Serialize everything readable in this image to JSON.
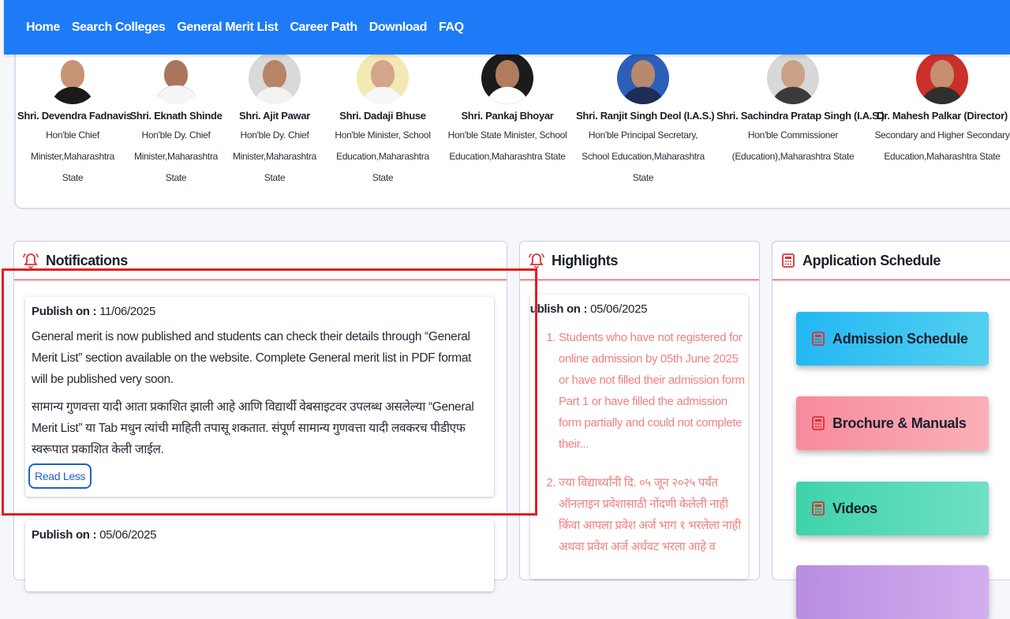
{
  "nav": {
    "items": [
      "Home",
      "Search Colleges",
      "General Merit List",
      "Career Path",
      "Download",
      "FAQ"
    ]
  },
  "dignitaries": [
    {
      "name": "Shri. Devendra Fadnavis",
      "role": [
        "Hon'ble Chief",
        "Minister,Maharashtra",
        "State"
      ],
      "accent": "#ffffff"
    },
    {
      "name": "Shri. Eknath Shinde",
      "role": [
        "Hon'ble Dy. Chief",
        "Minister,Maharashtra",
        "State"
      ],
      "accent": "#ffffff"
    },
    {
      "name": "Shri. Ajit Pawar",
      "role": [
        "Hon'ble Dy. Chief",
        "Minister,Maharashtra",
        "State"
      ],
      "accent": "#d9d9d9"
    },
    {
      "name": "Shri. Dadaji Bhuse",
      "role": [
        "Hon'ble Minister, School",
        "Education,Maharashtra",
        "State"
      ],
      "accent": "#f3e9b4"
    },
    {
      "name": "Shri. Pankaj Bhoyar",
      "role": [
        "Hon'ble State Minister, School",
        "Education,Maharashtra State"
      ],
      "accent": "#1b1b1b"
    },
    {
      "name": "Shri. Ranjit Singh Deol (I.A.S.)",
      "role": [
        "Hon'ble Principal Secretary,",
        "School Education,Maharashtra",
        "State"
      ],
      "accent": "#2c5fb8"
    },
    {
      "name": "Shri. Sachindra Pratap Singh (I.A.S.)",
      "role": [
        "Hon'ble Commissioner",
        "(Education),Maharashtra State"
      ],
      "accent": "#d8d8d8"
    },
    {
      "name": "Dr. Mahesh Palkar (Director)",
      "role": [
        "Secondary and Higher Secondary",
        "Education,Maharashtra State"
      ],
      "accent": "#c9302c"
    }
  ],
  "notifications": {
    "title": "Notifications",
    "items": [
      {
        "publish_label": "Publish on :",
        "date": "11/06/2025",
        "text_en": "General merit is now published and students can check their details through “General Merit List” section available on the website. Complete General merit list in PDF format will be published very soon.",
        "text_mr": "सामान्य गुणवत्ता यादी आता प्रकाशित झाली आहे आणि विद्यार्थी वेबसाइटवर उपलब्ध असलेल्या “General Merit List” या Tab मधुन त्यांची माहिती तपासू शकतात. संपूर्ण सामान्य गुणवत्ता यादी लवकरच पीडीएफ स्वरूपात प्रकाशित केली जाईल.",
        "toggle_label": "Read Less"
      },
      {
        "publish_label": "Publish on :",
        "date": "05/06/2025"
      }
    ]
  },
  "highlights": {
    "title": "Highlights",
    "publish_label": "Publish on :",
    "date": "05/06/2025",
    "items": [
      "Students who have not registered for online admission by 05th June 2025 or have not filled their admission form Part 1 or have filled the admission form partially and could not complete their...",
      "ज्या विद्यार्थ्यांनी दि. ०५ जून २०२५ पर्यंत ऑनलाइन प्रवेशासाठी नोंदणी केलेली नाही किंवा आपला प्रवेश अर्ज भाग १ भरलेला नाही अथवा प्रवेश अर्ज अर्धवट भरला आहे व"
    ]
  },
  "schedule": {
    "title": "Application Schedule",
    "buttons": [
      {
        "label": "Admission Schedule",
        "color": "#35c1f1"
      },
      {
        "label": "Brochure & Manuals",
        "color": "#f89aa8"
      },
      {
        "label": "Videos",
        "color": "#53d9b3"
      },
      {
        "label": "",
        "color": "#c79be0"
      }
    ]
  },
  "colors": {
    "nav_bg": "#1e7bf7",
    "accent_red": "#e03030",
    "highlight_text": "#f08080",
    "link_blue": "#1d61c9"
  }
}
